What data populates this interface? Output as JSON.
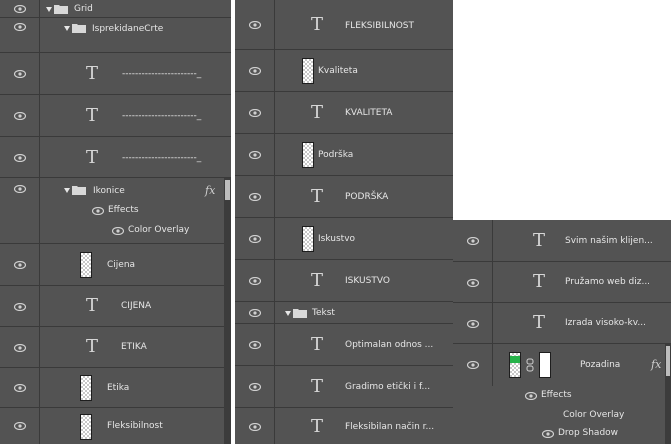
{
  "panel_left": {
    "rows": [
      {
        "label": "Grid"
      },
      {
        "label": "IsprekidaneCrte"
      },
      {
        "label": "-----------------------_"
      },
      {
        "label": "-----------------------_"
      },
      {
        "label": "-----------------------_"
      },
      {
        "label": "Ikonice",
        "effects": "Effects",
        "effect1": "Color Overlay"
      },
      {
        "label": "Cijena"
      },
      {
        "label": "CIJENA"
      },
      {
        "label": "ETIKA"
      },
      {
        "label": "Etika"
      },
      {
        "label": "Fleksibilnost"
      }
    ]
  },
  "panel_mid": {
    "rows": [
      {
        "label": "FLEKSIBILNOST"
      },
      {
        "label": "Kvaliteta"
      },
      {
        "label": "KVALITETA"
      },
      {
        "label": "Podrška"
      },
      {
        "label": "PODRŠKA"
      },
      {
        "label": "Iskustvo"
      },
      {
        "label": "ISKUSTVO"
      },
      {
        "label": "Tekst"
      },
      {
        "label": "Optimalan odnos ..."
      },
      {
        "label": "Gradimo etički i f..."
      },
      {
        "label": "Fleksibilan način r..."
      }
    ]
  },
  "panel_right": {
    "rows": [
      {
        "label": "Svim našim klijen..."
      },
      {
        "label": "Pružamo web diz..."
      },
      {
        "label": "Izrada visoko-kv..."
      },
      {
        "label": "Pozadina",
        "effects": "Effects",
        "effect1": "Color Overlay",
        "effect2": "Drop Shadow"
      }
    ]
  },
  "fx_symbol": "fx",
  "colors": {
    "panel_bg": "#535353",
    "divider": "#3a3a3a",
    "text": "#e6e6e6",
    "mask_green": "#27b34a"
  }
}
